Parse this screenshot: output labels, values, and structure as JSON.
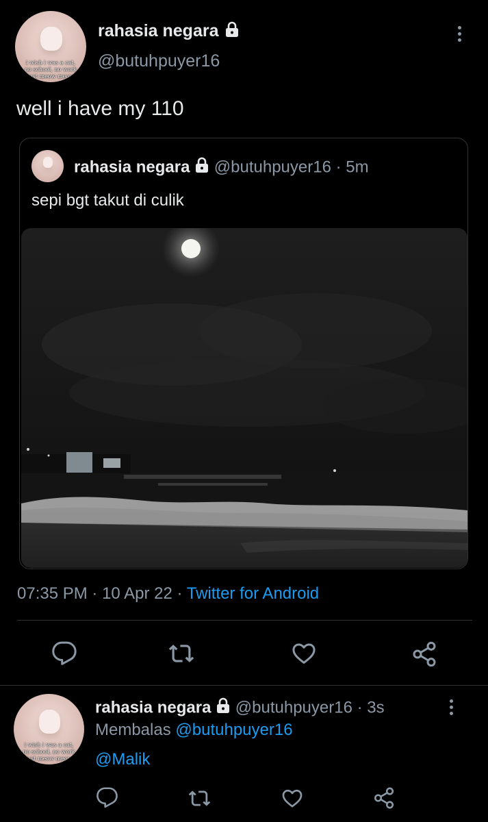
{
  "tweet": {
    "author_name": "rahasia negara",
    "author_handle": "@butuhpuyer16",
    "text": "well i have my 110",
    "avatar_caption": [
      "i wish i was a cat,",
      "no school, no work",
      "just meow meow"
    ]
  },
  "quoted": {
    "author_name": "rahasia negara",
    "author_handle": "@butuhpuyer16",
    "separator": "·",
    "time": "5m",
    "text": "sepi bgt takut di culik"
  },
  "meta": {
    "time": "07:35 PM",
    "separator1": "·",
    "date": "10 Apr 22",
    "separator2": "·",
    "source": "Twitter for Android"
  },
  "reply": {
    "author_name": "rahasia negara",
    "author_handle": "@butuhpuyer16",
    "separator": "·",
    "time": "3s",
    "replying_prefix": "Membalas",
    "replying_to": "@butuhpuyer16",
    "text": "@Malik",
    "avatar_caption": [
      "i wish i was a cat,",
      "no school, no work",
      "just meow meow"
    ]
  },
  "icons": {
    "reply": "reply-icon",
    "retweet": "retweet-icon",
    "like": "heart-icon",
    "share": "share-icon",
    "lock": "lock-icon",
    "more": "more-vertical-icon"
  },
  "colors": {
    "background": "#000000",
    "text": "#e7e9ea",
    "secondary": "#8b98a5",
    "link": "#1d9bf0",
    "border": "#2f3336"
  }
}
